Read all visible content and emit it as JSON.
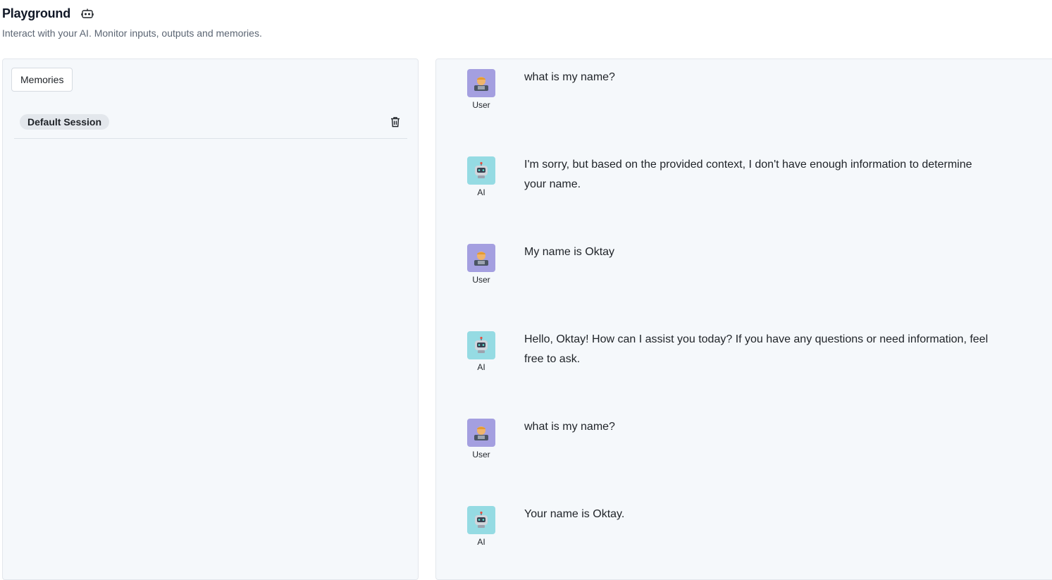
{
  "header": {
    "title": "Playground",
    "title_icon": "chat-bot-icon",
    "subtitle": "Interact with your AI. Monitor inputs, outputs and memories."
  },
  "left_panel": {
    "memories_label": "Memories",
    "sessions": [
      {
        "name": "Default Session",
        "delete_icon": "trash-icon"
      }
    ]
  },
  "chat": {
    "messages": [
      {
        "role": "User",
        "avatar_icon": "user-technologist-icon",
        "text": "what is my name?"
      },
      {
        "role": "AI",
        "avatar_icon": "robot-icon",
        "text": "I'm sorry, but based on the provided context, I don't have enough information to determine your name."
      },
      {
        "role": "User",
        "avatar_icon": "user-technologist-icon",
        "text": "My name is Oktay"
      },
      {
        "role": "AI",
        "avatar_icon": "robot-icon",
        "text": "Hello, Oktay! How can I assist you today? If you have any questions or need information, feel free to ask."
      },
      {
        "role": "User",
        "avatar_icon": "user-technologist-icon",
        "text": "what is my name?"
      },
      {
        "role": "AI",
        "avatar_icon": "robot-icon",
        "text": "Your name is Oktay."
      }
    ]
  },
  "colors": {
    "user_avatar_bg": "#a49fe0",
    "ai_avatar_bg": "#95dbe3",
    "panel_bg": "#f5f8fb"
  }
}
